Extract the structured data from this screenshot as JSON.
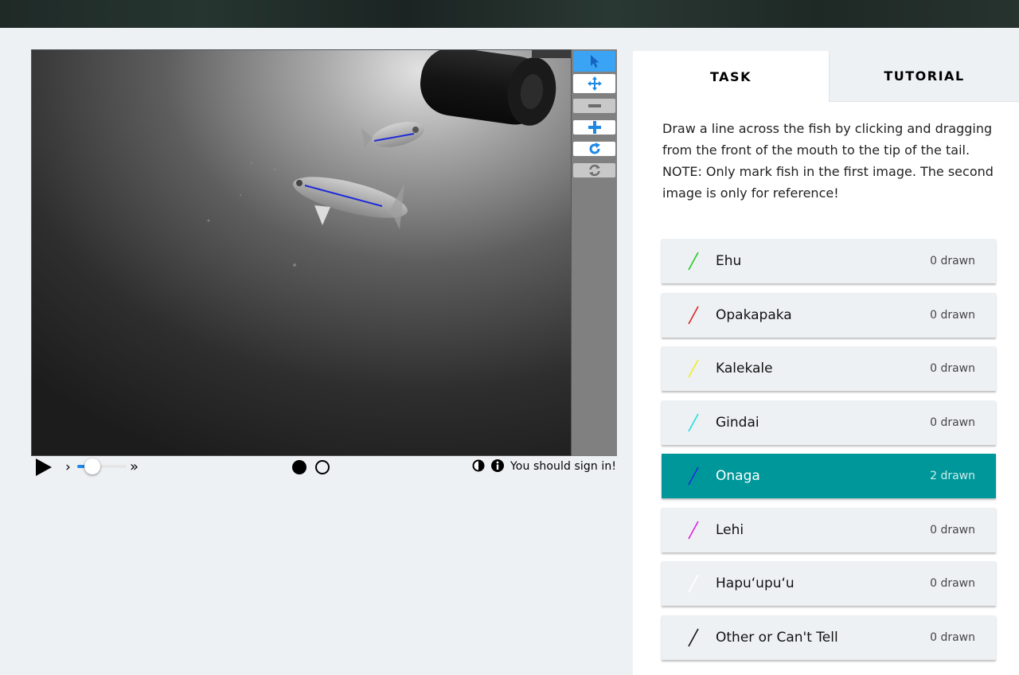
{
  "toolbar": {
    "tools": [
      {
        "name": "pointer-tool",
        "icon": "pointer-icon",
        "state": "active"
      },
      {
        "name": "move-tool",
        "icon": "move-icon",
        "state": "normal"
      },
      {
        "name": "zoom-out-tool",
        "icon": "minus-icon",
        "state": "disabled"
      },
      {
        "name": "zoom-in-tool",
        "icon": "plus-icon",
        "state": "normal"
      },
      {
        "name": "rotate-tool",
        "icon": "rotate-icon",
        "state": "normal"
      },
      {
        "name": "reset-tool",
        "icon": "reset-icon",
        "state": "disabled"
      }
    ],
    "active_color": "#3aa3f4"
  },
  "controls": {
    "play_icon": "play-icon",
    "slow_label": "›",
    "fast_label": "»",
    "speed_level": 0.3,
    "frames": [
      {
        "state": "filled"
      },
      {
        "state": "empty"
      }
    ],
    "contrast_icon": "contrast-icon",
    "info_icon": "info-icon",
    "signin_text": "You should sign in!"
  },
  "panel": {
    "tabs": [
      {
        "label": "TASK",
        "active": true
      },
      {
        "label": "TUTORIAL",
        "active": false
      }
    ],
    "instructions": [
      "Draw a line across the fish by clicking and dragging from the front of the mouth to the tip of the tail.",
      "NOTE: Only mark fish in the first image. The second image is only for reference!"
    ],
    "choices": [
      {
        "label": "Ehu",
        "count": "0 drawn",
        "color": "#22cc22",
        "selected": false
      },
      {
        "label": "Opakapaka",
        "count": "0 drawn",
        "color": "#dd2222",
        "selected": false
      },
      {
        "label": "Kalekale",
        "count": "0 drawn",
        "color": "#eeee22",
        "selected": false
      },
      {
        "label": "Gindai",
        "count": "0 drawn",
        "color": "#22dddd",
        "selected": false
      },
      {
        "label": "Onaga",
        "count": "2 drawn",
        "color": "#1f2bd8",
        "selected": true
      },
      {
        "label": "Lehi",
        "count": "0 drawn",
        "color": "#dd22dd",
        "selected": false
      },
      {
        "label": "Hapu‘upu‘u",
        "count": "0 drawn",
        "color": "#ffffff",
        "selected": false
      },
      {
        "label": "Other or Can't Tell",
        "count": "0 drawn",
        "color": "#111111",
        "selected": false
      }
    ],
    "selected_color": "#00979a"
  }
}
